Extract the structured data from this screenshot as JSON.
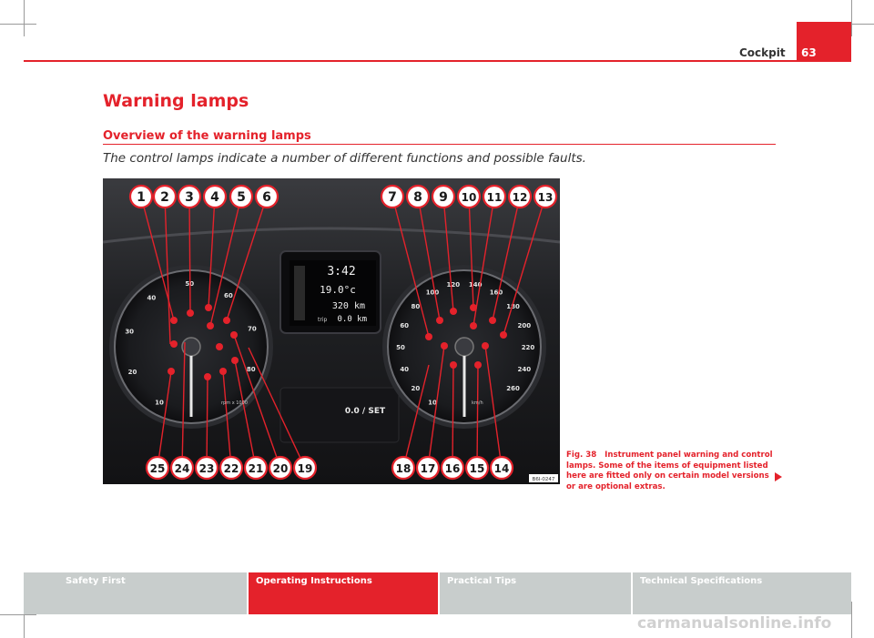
{
  "header": {
    "section": "Cockpit",
    "page_number": "63"
  },
  "title": "Warning lamps",
  "subtitle": "Overview of the warning lamps",
  "intro": "The control lamps indicate a number of different functions and possible faults.",
  "figure": {
    "callouts_top": [
      "1",
      "2",
      "3",
      "4",
      "5",
      "6",
      "7",
      "8",
      "9",
      "10",
      "11",
      "12",
      "13"
    ],
    "callouts_bottom": [
      "25",
      "24",
      "23",
      "22",
      "21",
      "20",
      "19",
      "18",
      "17",
      "16",
      "15",
      "14"
    ],
    "display": {
      "time": "3:42",
      "temp": "19.0°c",
      "range": "320 km",
      "trip_label": "trip",
      "trip": "0.0 km"
    },
    "center_label": "0.0 / SET",
    "rpm_label": "rpm x 1000",
    "speed_label": "km/h",
    "code": "B6I-0247",
    "tach_ticks": [
      "10",
      "20",
      "30",
      "40",
      "50",
      "60",
      "70",
      "80"
    ],
    "speed_ticks": [
      "10",
      "20",
      "40",
      "50",
      "60",
      "80",
      "100",
      "120",
      "140",
      "160",
      "180",
      "200",
      "220",
      "240",
      "260"
    ]
  },
  "caption": {
    "label": "Fig. 38",
    "text": "Instrument panel warning and control lamps. Some of the items of equipment listed here are fitted only on certain model versions or are optional extras."
  },
  "footer": [
    "Safety First",
    "Operating Instructions",
    "Practical Tips",
    "Technical Specifications"
  ],
  "watermark": "carmanualsonline.info",
  "colors": {
    "accent": "#e4222b",
    "footer_gray": "#c8cdcc"
  }
}
